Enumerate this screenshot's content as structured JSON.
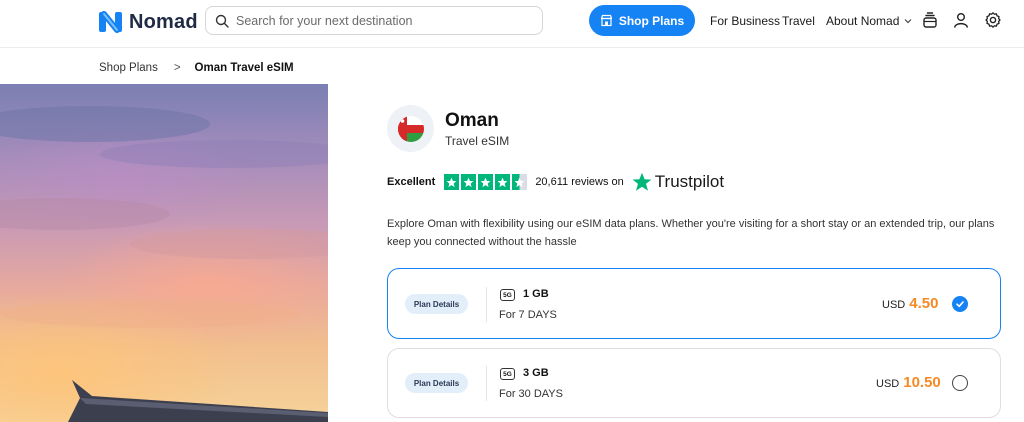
{
  "header": {
    "brand": "Nomad",
    "search_placeholder": "Search for your next destination",
    "shop_plans": "Shop Plans",
    "nav": [
      "For Business",
      "Travel",
      "About Nomad"
    ],
    "icons": [
      "orders-icon",
      "user-icon",
      "settings-icon"
    ]
  },
  "breadcrumb": {
    "parent": "Shop Plans",
    "separator": ">",
    "current": "Oman Travel eSIM"
  },
  "product": {
    "country": "Oman",
    "subtitle": "Travel eSIM",
    "flag_colors": {
      "red": "#d62a2a",
      "white": "#ffffff",
      "green": "#2e9e43"
    }
  },
  "rating": {
    "label": "Excellent",
    "stars": 4.5,
    "reviews_text": "20,611 reviews on",
    "provider": "Trustpilot"
  },
  "description": "Explore Oman with flexibility using our eSIM data plans. Whether you're visiting for a short stay or an extended trip, our plans keep you connected without the hassle",
  "plans": [
    {
      "details_label": "Plan Details",
      "network": "5G",
      "data": "1 GB",
      "duration": "For 7 DAYS",
      "currency": "USD",
      "price": "4.50",
      "selected": true
    },
    {
      "details_label": "Plan Details",
      "network": "5G",
      "data": "3 GB",
      "duration": "For 30 DAYS",
      "currency": "USD",
      "price": "10.50",
      "selected": false
    }
  ],
  "colors": {
    "accent": "#1683f5",
    "price": "#f58a24",
    "trustpilot_green": "#00b67a"
  }
}
